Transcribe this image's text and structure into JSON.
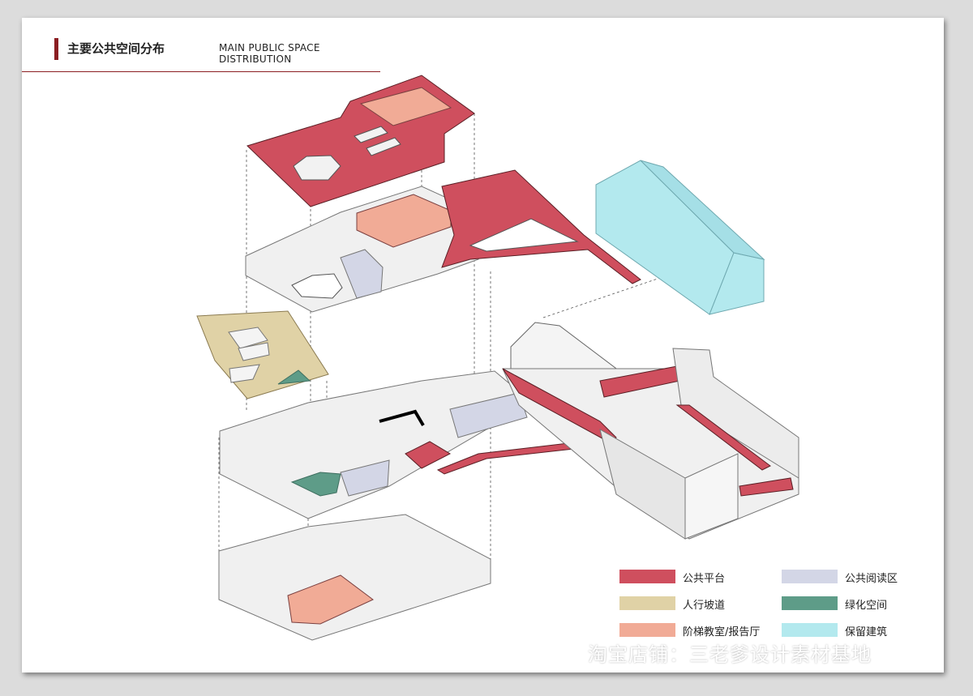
{
  "title": {
    "cn": "主要公共空间分布",
    "en": "MAIN PUBLIC SPACE DISTRIBUTION"
  },
  "colors": {
    "public_platform": "#cf4f5e",
    "ramp": "#e0d2a6",
    "lecture_hall": "#f1ab96",
    "reading_area": "#d3d6e6",
    "green_space": "#5e9c88",
    "heritage": "#b3e9ee",
    "accent": "#8b1e22"
  },
  "legend": [
    {
      "label": "公共平台",
      "color": "#cf4f5e"
    },
    {
      "label": "人行坡道",
      "color": "#e0d2a6"
    },
    {
      "label": "阶梯教室/报告厅",
      "color": "#f1ab96"
    },
    {
      "label": "公共阅读区",
      "color": "#d3d6e6"
    },
    {
      "label": "绿化空间",
      "color": "#5e9c88"
    },
    {
      "label": "保留建筑",
      "color": "#b3e9ee"
    }
  ],
  "watermark": "淘宝店铺：三老爹设计素材基地"
}
